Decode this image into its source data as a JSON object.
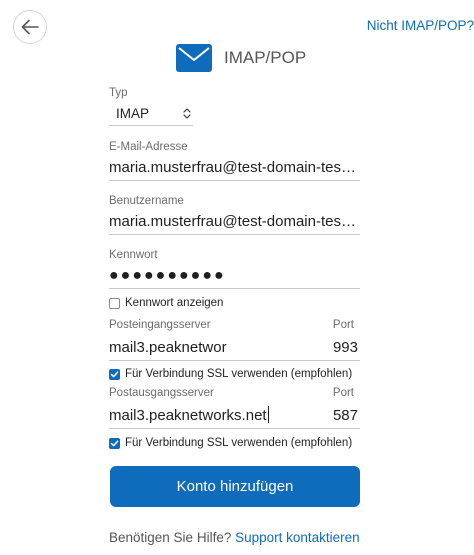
{
  "top_link": "Nicht IMAP/POP?",
  "header": {
    "title": "IMAP/POP",
    "icon": "mail-icon"
  },
  "form": {
    "type": {
      "label": "Typ",
      "value": "IMAP"
    },
    "email": {
      "label": "E-Mail-Adresse",
      "value": "maria.musterfrau@test-domain-tes…"
    },
    "username": {
      "label": "Benutzername",
      "value": "maria.musterfrau@test-domain-tes…"
    },
    "password": {
      "label": "Kennwort",
      "value": "●●●●●●●●●●"
    },
    "show_password": {
      "label": "Kennwort anzeigen",
      "checked": false
    },
    "incoming": {
      "label": "Posteingangsserver",
      "port_label": "Port",
      "server": "mail3.peaknetwor",
      "port": "993",
      "ssl_label": "Für Verbindung SSL verwenden (empfohlen)",
      "ssl_checked": true
    },
    "outgoing": {
      "label": "Postausgangsserver",
      "port_label": "Port",
      "server": "mail3.peaknetworks.net",
      "port": "587",
      "ssl_label": "Für Verbindung SSL verwenden (empfohlen)",
      "ssl_checked": true
    }
  },
  "submit_label": "Konto hinzufügen",
  "help": {
    "text": "Benötigen Sie Hilfe?",
    "link": "Support kontaktieren"
  },
  "colors": {
    "accent": "#0f6cbd",
    "text": "#1f1f1f",
    "muted": "#6b6b6b"
  }
}
